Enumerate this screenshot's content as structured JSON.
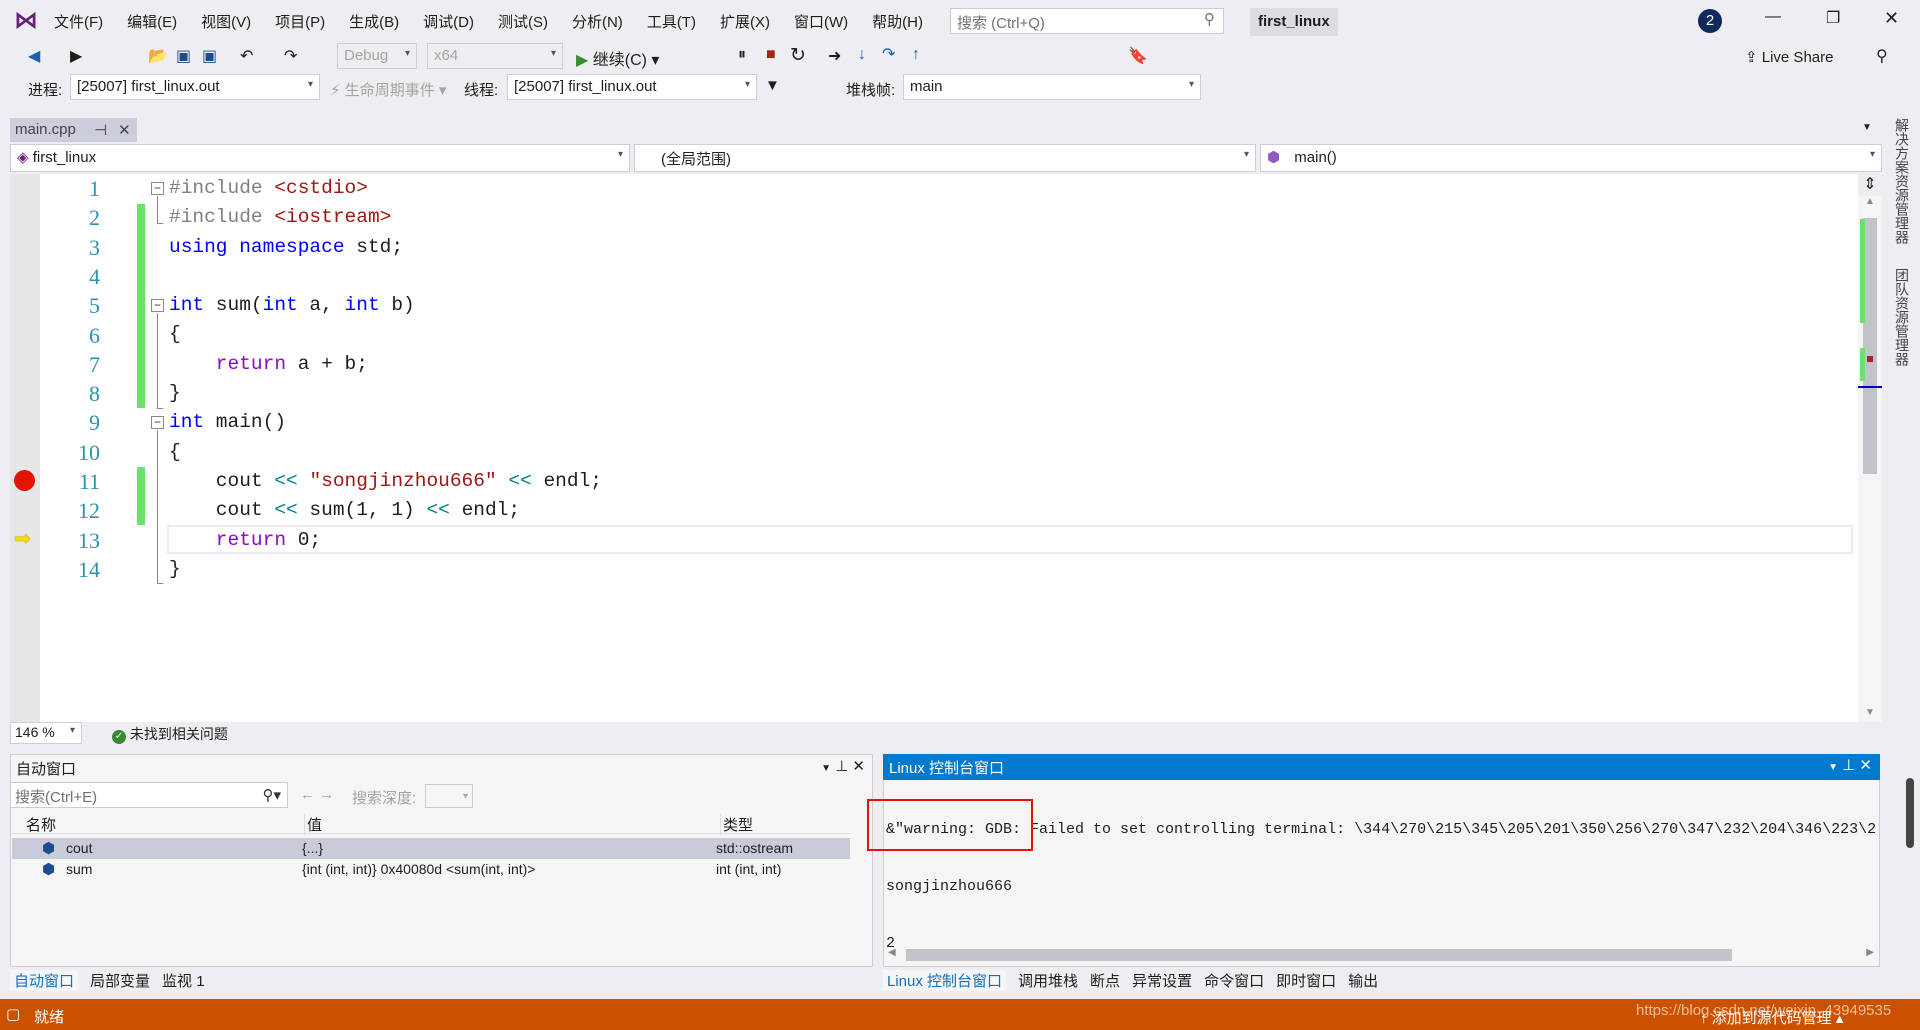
{
  "title_bar": {
    "menus": [
      "文件(F)",
      "编辑(E)",
      "视图(V)",
      "项目(P)",
      "生成(B)",
      "调试(D)",
      "测试(S)",
      "分析(N)",
      "工具(T)",
      "扩展(X)",
      "窗口(W)",
      "帮助(H)"
    ],
    "search_placeholder": "搜索 (Ctrl+Q)",
    "solution_name": "first_linux",
    "notification_count": "2"
  },
  "toolbar": {
    "config": "Debug",
    "platform": "x64",
    "continue_label": "继续(C)",
    "live_share": "Live Share"
  },
  "debug_bar": {
    "process_label": "进程:",
    "process_value": "[25007] first_linux.out",
    "lifecycle_label": "生命周期事件",
    "thread_label": "线程:",
    "thread_value": "[25007] first_linux.out",
    "stack_label": "堆栈帧:",
    "stack_value": "main"
  },
  "editor": {
    "tab": "main.cpp",
    "project_scope": "first_linux",
    "global_scope": "(全局范围)",
    "function_scope": "main()",
    "zoom": "146 %",
    "issues": "未找到相关问题",
    "lines": [
      [
        [
          "pp",
          "#include "
        ],
        [
          "inc",
          "<cstdio>"
        ]
      ],
      [
        [
          "pp",
          "#include "
        ],
        [
          "inc",
          "<iostream>"
        ]
      ],
      [
        [
          "kw",
          "using namespace"
        ],
        [
          "id",
          " std;"
        ]
      ],
      [],
      [
        [
          "kw",
          "int"
        ],
        [
          "id",
          " sum("
        ],
        [
          "kw",
          "int"
        ],
        [
          "id",
          " a, "
        ],
        [
          "kw",
          "int"
        ],
        [
          "id",
          " b)"
        ]
      ],
      [
        [
          "id",
          "{"
        ]
      ],
      [
        [
          "ctl",
          "    return"
        ],
        [
          "id",
          " a + b;"
        ]
      ],
      [
        [
          "id",
          "}"
        ]
      ],
      [
        [
          "kw",
          "int"
        ],
        [
          "id",
          " main()"
        ]
      ],
      [
        [
          "id",
          "{"
        ]
      ],
      [
        [
          "id",
          "    cout "
        ],
        [
          "op",
          "<<"
        ],
        [
          "id",
          " "
        ],
        [
          "str",
          "\"songjinzhou666\""
        ],
        [
          "id",
          " "
        ],
        [
          "op",
          "<<"
        ],
        [
          "id",
          " endl;"
        ]
      ],
      [
        [
          "id",
          "    cout "
        ],
        [
          "op",
          "<<"
        ],
        [
          "id",
          " sum(1, 1) "
        ],
        [
          "op",
          "<<"
        ],
        [
          "id",
          " endl;"
        ]
      ],
      [
        [
          "ctl",
          "    return"
        ],
        [
          "id",
          " 0;"
        ]
      ],
      [
        [
          "id",
          "}"
        ]
      ]
    ],
    "breakpoint_line": 11,
    "current_line": 13
  },
  "side_tabs": [
    "解决方案资源管理器",
    "团队资源管理器"
  ],
  "autos": {
    "title": "自动窗口",
    "search_placeholder": "搜索(Ctrl+E)",
    "depth_label": "搜索深度:",
    "columns": [
      "名称",
      "值",
      "类型"
    ],
    "rows": [
      {
        "name": "cout",
        "value": "{...}",
        "type": "std::ostream"
      },
      {
        "name": "sum",
        "value": "{int (int, int)} 0x40080d <sum(int, int)>",
        "type": "int (int, int)"
      }
    ],
    "tabs": [
      "自动窗口",
      "局部变量",
      "监视 1"
    ]
  },
  "console": {
    "title": "Linux 控制台窗口",
    "lines": [
      "&\"warning: GDB: Failed to set controlling terminal: \\344\\270\\215\\345\\205\\201\\350\\256\\270\\347\\232\\204\\346\\223\\2",
      "songjinzhou666",
      "2"
    ],
    "tabs": [
      "Linux 控制台窗口",
      "调用堆栈",
      "断点",
      "异常设置",
      "命令窗口",
      "即时窗口",
      "输出"
    ]
  },
  "status_bar": {
    "text": "就绪",
    "right": "添加到源代码管理",
    "watermark": "https://blog.csdn.net/weixin_43949535",
    "color": "#ca5100"
  }
}
